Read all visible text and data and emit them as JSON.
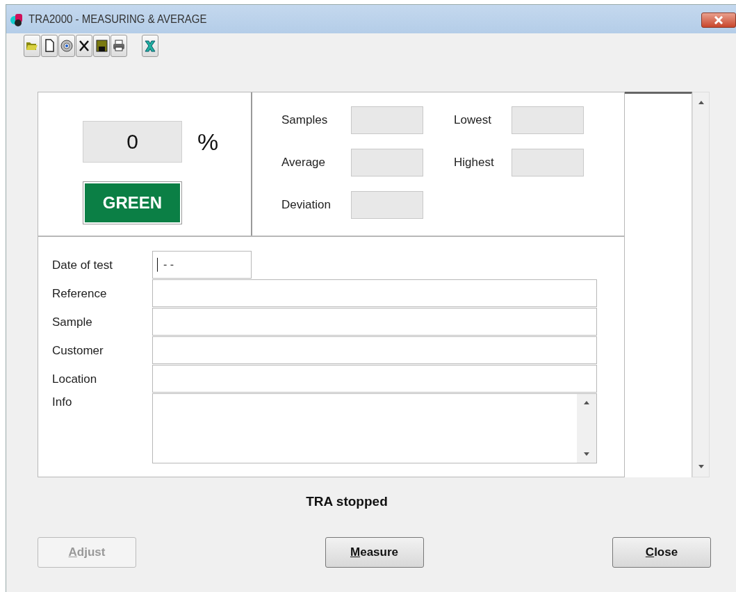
{
  "window": {
    "title": "TRA2000 - MEASURING & AVERAGE"
  },
  "result": {
    "value": "0",
    "unit": "%",
    "status": "GREEN",
    "color": "#0b7f45"
  },
  "stats": [
    {
      "label": "Samples"
    },
    {
      "label": "Lowest"
    },
    {
      "label": "Average"
    },
    {
      "label": "Highest"
    },
    {
      "label": "Deviation"
    }
  ],
  "fields": [
    {
      "label": "Date of test",
      "kind": "date",
      "value": "- -"
    },
    {
      "label": "Reference",
      "kind": "text"
    },
    {
      "label": "Sample",
      "kind": "text"
    },
    {
      "label": "Customer",
      "kind": "text"
    },
    {
      "label": "Location",
      "kind": "text"
    },
    {
      "label": "Info",
      "kind": "memo"
    }
  ],
  "status_message": "TRA stopped",
  "buttons": [
    {
      "label": "Adjust",
      "disabled": true
    },
    {
      "label": "Measure",
      "disabled": false
    },
    {
      "label": "Close",
      "disabled": false
    }
  ]
}
